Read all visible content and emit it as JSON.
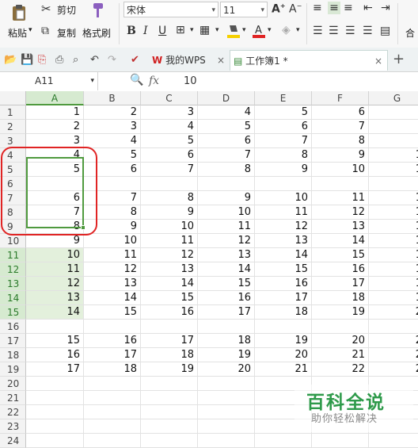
{
  "ribbon": {
    "cut": "剪切",
    "paste": "粘贴",
    "copy": "复制",
    "format_painter": "格式刷",
    "font_name": "宋体",
    "font_size": "11",
    "partial_right": "合"
  },
  "tabs": [
    {
      "label": "我的WPS"
    },
    {
      "label": "工作簿1 *"
    }
  ],
  "formula_bar": {
    "cell_ref": "A11",
    "fx": "fx",
    "value": "10"
  },
  "columns": [
    "A",
    "B",
    "C",
    "D",
    "E",
    "F",
    "G"
  ],
  "rows": [
    {
      "n": "1",
      "cells": [
        "1",
        "2",
        "3",
        "4",
        "5",
        "6",
        ""
      ]
    },
    {
      "n": "2",
      "cells": [
        "2",
        "3",
        "4",
        "5",
        "6",
        "7",
        ""
      ]
    },
    {
      "n": "3",
      "cells": [
        "3",
        "4",
        "5",
        "6",
        "7",
        "8",
        ""
      ]
    },
    {
      "n": "4",
      "cells": [
        "4",
        "5",
        "6",
        "7",
        "8",
        "9",
        "1"
      ]
    },
    {
      "n": "5",
      "cells": [
        "5",
        "6",
        "7",
        "8",
        "9",
        "10",
        "1"
      ]
    },
    {
      "n": "6",
      "cells": [
        "",
        "",
        "",
        "",
        "",
        "",
        ""
      ]
    },
    {
      "n": "7",
      "cells": [
        "6",
        "7",
        "8",
        "9",
        "10",
        "11",
        "1"
      ]
    },
    {
      "n": "8",
      "cells": [
        "7",
        "8",
        "9",
        "10",
        "11",
        "12",
        "1"
      ]
    },
    {
      "n": "9",
      "cells": [
        "8",
        "9",
        "10",
        "11",
        "12",
        "13",
        "1"
      ]
    },
    {
      "n": "10",
      "cells": [
        "9",
        "10",
        "11",
        "12",
        "13",
        "14",
        "1"
      ]
    },
    {
      "n": "11",
      "cells": [
        "10",
        "11",
        "12",
        "13",
        "14",
        "15",
        "1"
      ]
    },
    {
      "n": "12",
      "cells": [
        "11",
        "12",
        "13",
        "14",
        "15",
        "16",
        "1"
      ]
    },
    {
      "n": "13",
      "cells": [
        "12",
        "13",
        "14",
        "15",
        "16",
        "17",
        "1"
      ]
    },
    {
      "n": "14",
      "cells": [
        "13",
        "14",
        "15",
        "16",
        "17",
        "18",
        "1"
      ]
    },
    {
      "n": "15",
      "cells": [
        "14",
        "15",
        "16",
        "17",
        "18",
        "19",
        "2"
      ]
    },
    {
      "n": "16",
      "cells": [
        "",
        "",
        "",
        "",
        "",
        "",
        ""
      ]
    },
    {
      "n": "17",
      "cells": [
        "15",
        "16",
        "17",
        "18",
        "19",
        "20",
        "2"
      ]
    },
    {
      "n": "18",
      "cells": [
        "16",
        "17",
        "18",
        "19",
        "20",
        "21",
        "2"
      ]
    },
    {
      "n": "19",
      "cells": [
        "17",
        "18",
        "19",
        "20",
        "21",
        "22",
        "2"
      ]
    },
    {
      "n": "20",
      "cells": [
        "",
        "",
        "",
        "",
        "",
        "",
        ""
      ]
    },
    {
      "n": "21",
      "cells": [
        "",
        "",
        "",
        "",
        "",
        "",
        ""
      ]
    },
    {
      "n": "22",
      "cells": [
        "",
        "",
        "",
        "",
        "",
        "",
        ""
      ]
    },
    {
      "n": "23",
      "cells": [
        "",
        "",
        "",
        "",
        "",
        "",
        ""
      ]
    },
    {
      "n": "24",
      "cells": [
        "",
        "",
        "",
        "",
        "",
        "",
        ""
      ]
    }
  ],
  "selection": {
    "column": "A",
    "rows": [
      "11",
      "12",
      "13",
      "14",
      "15"
    ]
  },
  "watermark": {
    "title": "百科全说",
    "subtitle": "助你轻松解决"
  },
  "colors": {
    "selection": "#4f9a3e",
    "annotation": "#e02424",
    "watermark": "#2e9a4a"
  }
}
